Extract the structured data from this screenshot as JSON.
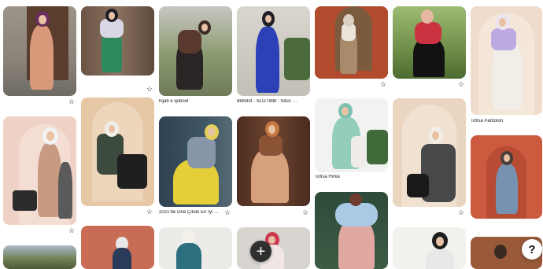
{
  "feed": {
    "captions": {
      "c3_1": "hijab e qubool",
      "c4_1": "888slot - SLOT888 : Situs Slo...",
      "c7_1": "Tofisa Pantolon",
      "c3_2": "2021'de Öne Çıkan En İyi 47...",
      "c5_2": "Tofisa Hırka"
    },
    "save_icon": "star-icon",
    "save_glyph": "☆"
  },
  "controls": {
    "create_glyph": "+",
    "create_icon": "plus-icon",
    "help_glyph": "?",
    "help_icon": "question-icon"
  }
}
